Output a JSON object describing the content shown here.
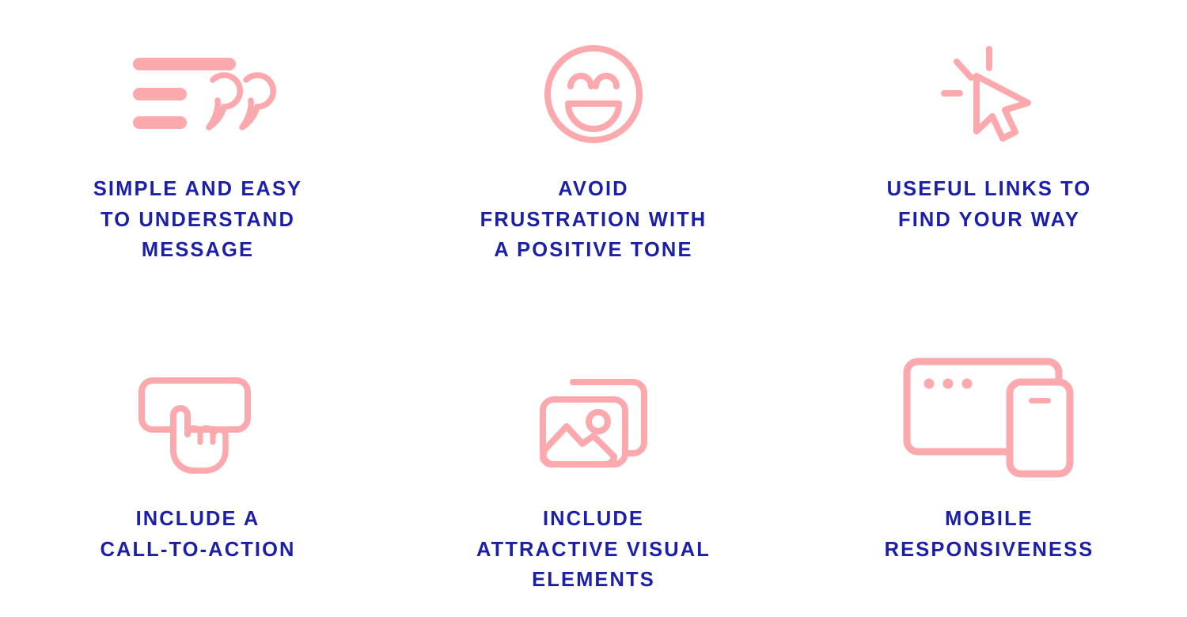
{
  "theme": {
    "background": "#ffffff",
    "icon_color": "#fca9ae",
    "text_color": "#1c1fa8"
  },
  "features": [
    {
      "icon": "text-lines-quote-icon",
      "caption": "SIMPLE AND EASY\nTO UNDERSTAND\nMESSAGE"
    },
    {
      "icon": "smiling-face-icon",
      "caption": "AVOID\nFRUSTRATION WITH\nA POSITIVE TONE"
    },
    {
      "icon": "click-cursor-icon",
      "caption": "USEFUL LINKS TO\nFIND YOUR WAY"
    },
    {
      "icon": "button-click-hand-icon",
      "caption": "INCLUDE A\nCALL-TO-ACTION"
    },
    {
      "icon": "stacked-images-icon",
      "caption": "INCLUDE\nATTRACTIVE VISUAL\nELEMENTS"
    },
    {
      "icon": "browser-and-phone-icon",
      "caption": "MOBILE\nRESPONSIVENESS"
    }
  ]
}
